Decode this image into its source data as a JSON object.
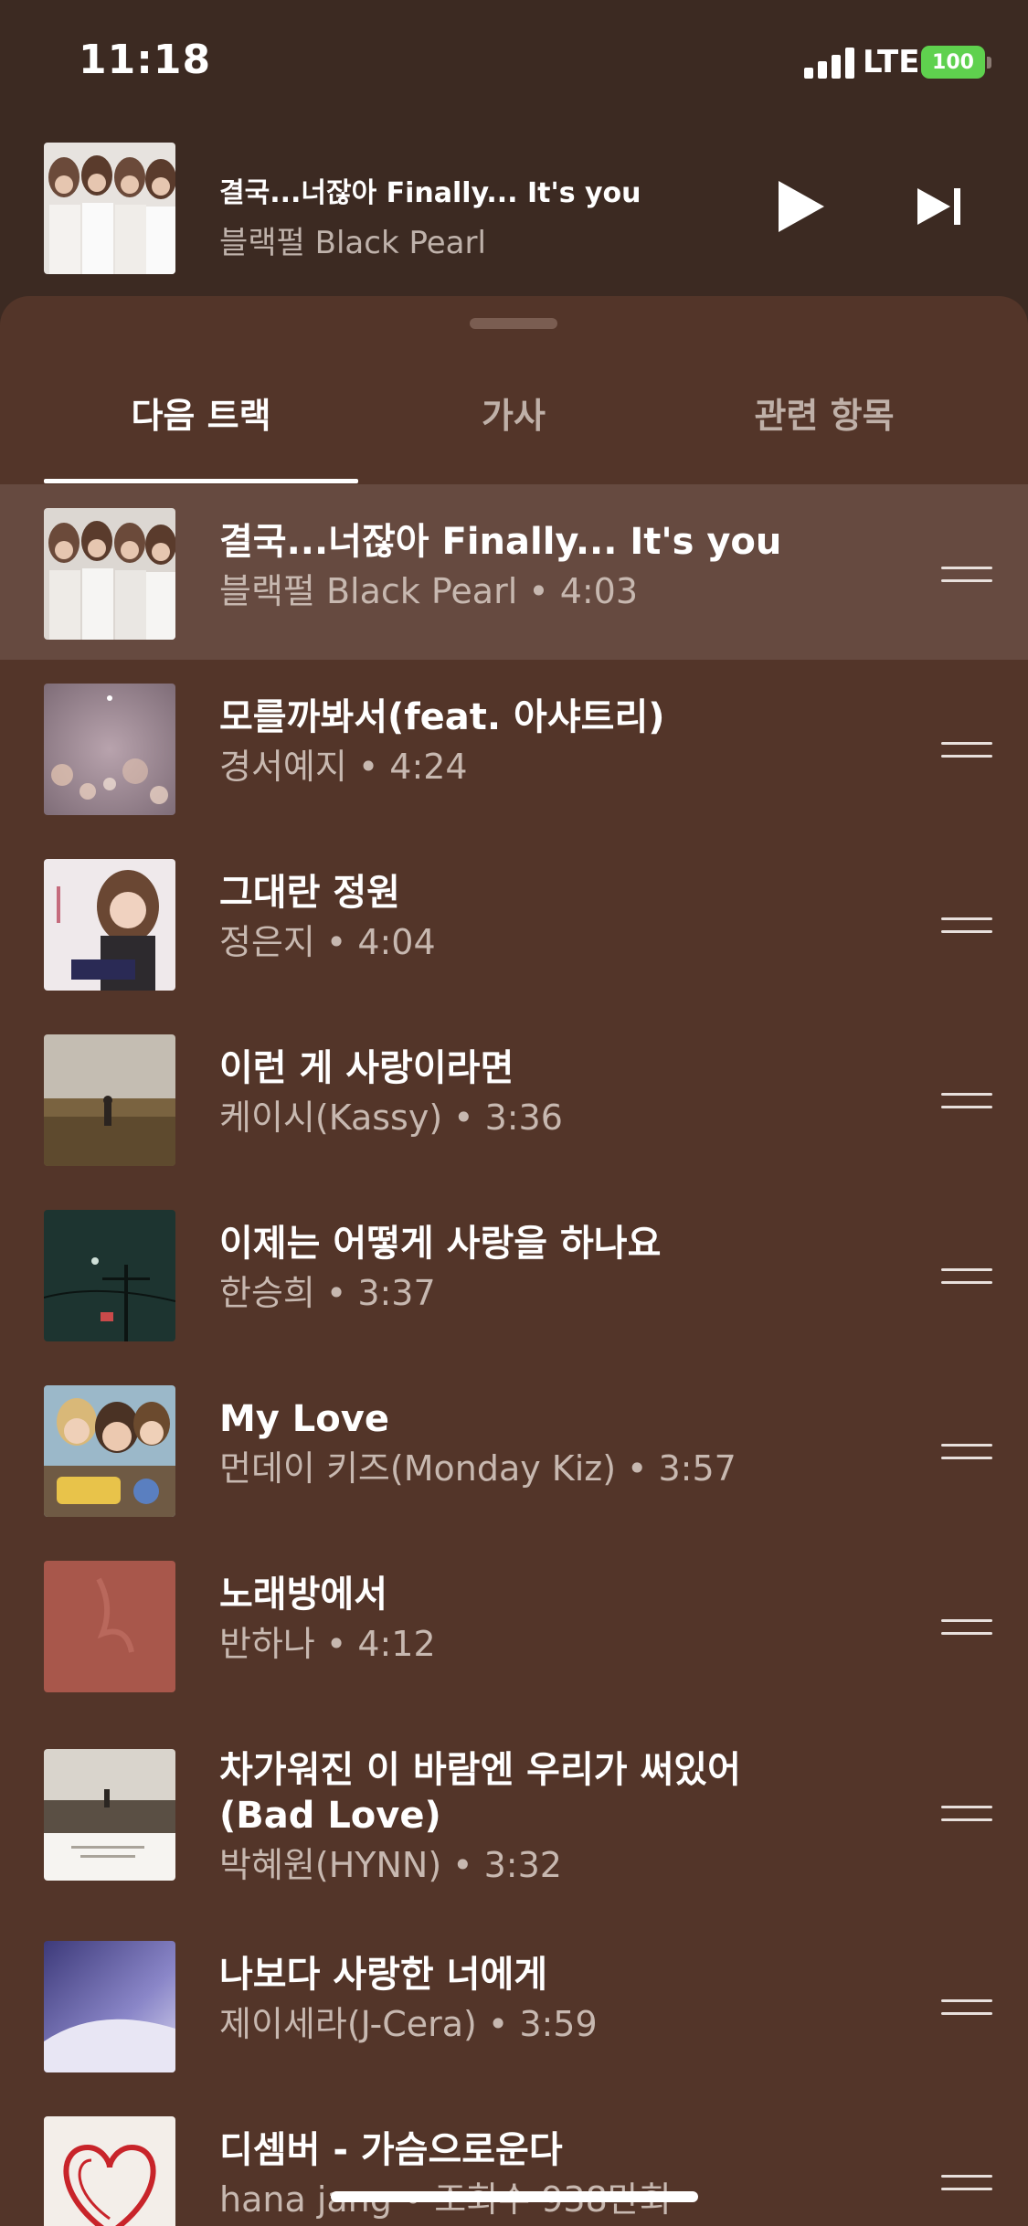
{
  "status_bar": {
    "time": "11:18",
    "network": "LTE",
    "battery": "100"
  },
  "mini_player": {
    "title": "결국...너잖아 Finally... It's you",
    "artist": "블랙펄 Black Pearl",
    "play_icon": "play-icon",
    "next_icon": "skip-next-icon"
  },
  "tabs": [
    {
      "label": "다음 트랙",
      "active": true
    },
    {
      "label": "가사",
      "active": false
    },
    {
      "label": "관련 항목",
      "active": false
    }
  ],
  "tracks": [
    {
      "title": "결국...너잖아 Finally... It's you",
      "artist": "블랙펄 Black Pearl",
      "duration": "4:03",
      "current": true,
      "art_color": "#d9d4cf"
    },
    {
      "title": "모를까봐서(feat. 아샤트리)",
      "artist": "경서예지",
      "duration": "4:24",
      "art_color": "#a08c98"
    },
    {
      "title": "그대란 정원",
      "artist": "정은지",
      "duration": "4:04",
      "art_color": "#e6dde0"
    },
    {
      "title": "이런 게 사랑이라면",
      "artist": "케이시(Kassy)",
      "duration": "3:36",
      "art_color": "#8a7556"
    },
    {
      "title": "이제는 어떻게 사랑을 하나요",
      "artist": "한승희",
      "duration": "3:37",
      "art_color": "#1f3a35"
    },
    {
      "title": "My Love",
      "artist": "먼데이 키즈(Monday Kiz)",
      "duration": "3:57",
      "art_color": "#8a6a52"
    },
    {
      "title": "노래방에서",
      "artist": "반하나",
      "duration": "4:12",
      "art_color": "#a8584c"
    },
    {
      "title": "차가워진 이 바람엔 우리가 써있어(Bad Love)",
      "artist": "박혜원(HYNN)",
      "duration": "3:32",
      "art_color": "#d7d1c9"
    },
    {
      "title": "나보다 사랑한 너에게",
      "artist": "제이세라(J-Cera)",
      "duration": "3:59",
      "art_color": "#6d67a6"
    },
    {
      "title": "디셈버 - 가슴으로운다",
      "artist": "hana jang",
      "duration": "조회수 938만회",
      "art_color": "#f2ede8"
    }
  ],
  "separator": "•",
  "drag_icon": "drag-handle-icon"
}
